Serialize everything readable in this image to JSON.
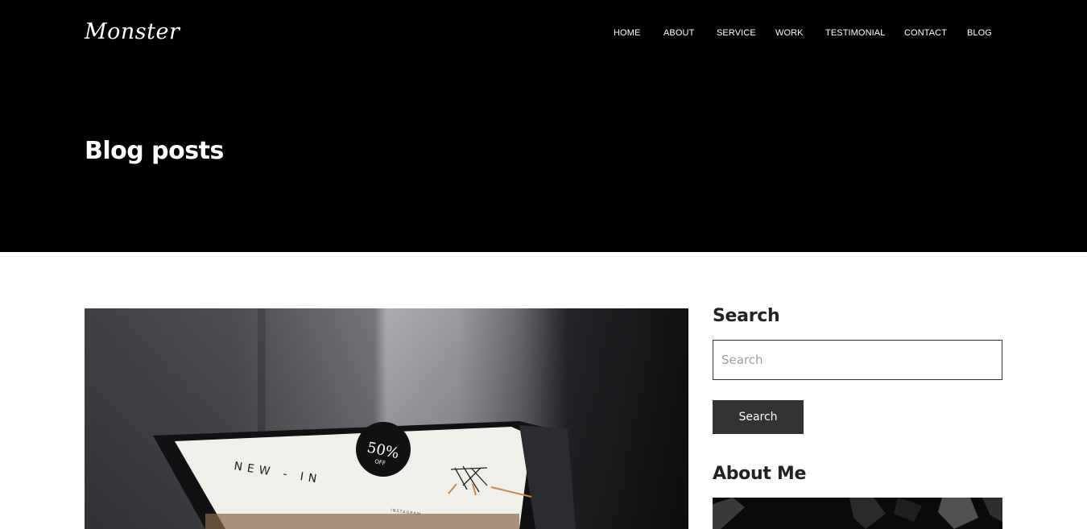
{
  "header": {
    "logo": "Monster",
    "nav": [
      "HOME",
      "ABOUT",
      "SERVICE",
      "WORK",
      "TESTIMONIAL",
      "CONTACT",
      "BLOG"
    ]
  },
  "hero": {
    "title": "Blog posts"
  },
  "post": {
    "image_text": {
      "headline": "NEW - IN",
      "badge_main": "50%",
      "badge_sub": "OFF",
      "caption": "INSTAGRAM"
    }
  },
  "sidebar": {
    "search": {
      "title": "Search",
      "placeholder": "Search",
      "button_label": "Search"
    },
    "about": {
      "title": "About Me"
    }
  },
  "colors": {
    "hero_background": "#000000",
    "button_background": "#333333",
    "text_dark": "#222222"
  }
}
